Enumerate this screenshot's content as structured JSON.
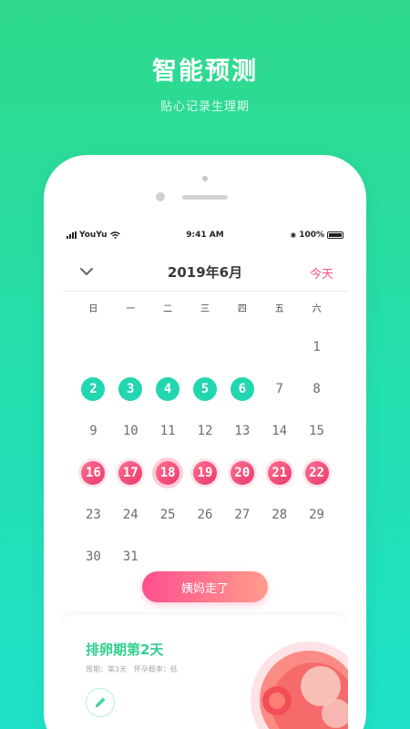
{
  "hero": {
    "title": "智能预测",
    "subtitle": "贴心记录生理期"
  },
  "status_bar": {
    "carrier": "YouYu",
    "time": "9:41 AM",
    "battery": "100%"
  },
  "header": {
    "month_title": "2019年6月",
    "today_label": "今天"
  },
  "weekdays": [
    "日",
    "一",
    "二",
    "三",
    "四",
    "五",
    "六"
  ],
  "calendar": {
    "leading_blanks": 6,
    "days": [
      {
        "d": "1",
        "s": ""
      },
      {
        "d": "2",
        "s": "green"
      },
      {
        "d": "3",
        "s": "green"
      },
      {
        "d": "4",
        "s": "green"
      },
      {
        "d": "5",
        "s": "green"
      },
      {
        "d": "6",
        "s": "green"
      },
      {
        "d": "7",
        "s": ""
      },
      {
        "d": "8",
        "s": ""
      },
      {
        "d": "9",
        "s": ""
      },
      {
        "d": "10",
        "s": ""
      },
      {
        "d": "11",
        "s": ""
      },
      {
        "d": "12",
        "s": ""
      },
      {
        "d": "13",
        "s": ""
      },
      {
        "d": "14",
        "s": ""
      },
      {
        "d": "15",
        "s": ""
      },
      {
        "d": "16",
        "s": "pink"
      },
      {
        "d": "17",
        "s": "pink"
      },
      {
        "d": "18",
        "s": "pink today"
      },
      {
        "d": "19",
        "s": "pink"
      },
      {
        "d": "20",
        "s": "pink"
      },
      {
        "d": "21",
        "s": "pink"
      },
      {
        "d": "22",
        "s": "pink"
      },
      {
        "d": "23",
        "s": ""
      },
      {
        "d": "24",
        "s": ""
      },
      {
        "d": "25",
        "s": ""
      },
      {
        "d": "26",
        "s": ""
      },
      {
        "d": "27",
        "s": ""
      },
      {
        "d": "28",
        "s": ""
      },
      {
        "d": "29",
        "s": ""
      },
      {
        "d": "30",
        "s": ""
      },
      {
        "d": "31",
        "s": ""
      }
    ]
  },
  "action_button": {
    "label": "姨妈走了"
  },
  "card": {
    "title": "排卵期第2天",
    "subtitle": "周期：第3天   怀孕概率：低"
  },
  "colors": {
    "green": "#22d6b0",
    "pink": "#ff4d8d",
    "accent_text": "#2fcf8f"
  },
  "icons": {
    "collapse": "chevron-down-icon",
    "edit": "pencil-icon",
    "illustration": "egg-cell-illustration"
  }
}
